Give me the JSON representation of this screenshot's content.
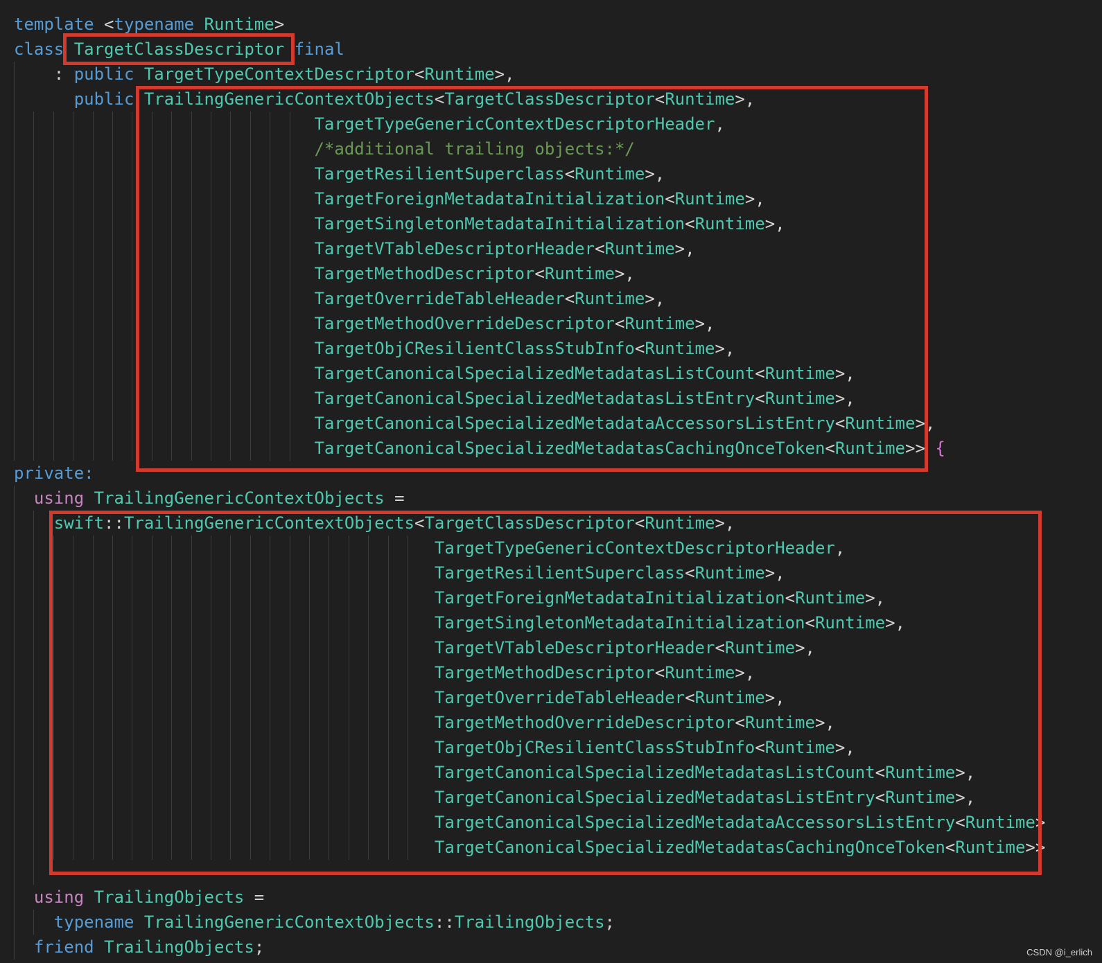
{
  "theme": {
    "background": "#1f1f1f",
    "keyword": "#569cd6",
    "control_keyword": "#c586c0",
    "type": "#4ec9b0",
    "identifier": "#9cdcfe",
    "text": "#d4d4d4",
    "comment": "#6a9955",
    "bracket": "#da70d6",
    "highlight_box": "#d13a2c"
  },
  "code_lines": [
    {
      "tokens": [
        {
          "t": "template",
          "c": "keyword"
        },
        {
          "t": " <",
          "c": "text"
        },
        {
          "t": "typename",
          "c": "keyword"
        },
        {
          "t": " ",
          "c": "text"
        },
        {
          "t": "Runtime",
          "c": "type"
        },
        {
          "t": ">",
          "c": "text"
        }
      ]
    },
    {
      "tokens": [
        {
          "t": "class",
          "c": "keyword"
        },
        {
          "t": " ",
          "c": "text"
        },
        {
          "t": "TargetClassDescriptor",
          "c": "type"
        },
        {
          "t": " ",
          "c": "text"
        },
        {
          "t": "final",
          "c": "keyword"
        }
      ]
    },
    {
      "tokens": [
        {
          "t": "    : ",
          "c": "text"
        },
        {
          "t": "public",
          "c": "keyword"
        },
        {
          "t": " ",
          "c": "text"
        },
        {
          "t": "TargetTypeContextDescriptor",
          "c": "type"
        },
        {
          "t": "<",
          "c": "text"
        },
        {
          "t": "Runtime",
          "c": "type"
        },
        {
          "t": ">,",
          "c": "text"
        }
      ]
    },
    {
      "tokens": [
        {
          "t": "      ",
          "c": "text"
        },
        {
          "t": "public",
          "c": "keyword"
        },
        {
          "t": " ",
          "c": "text"
        },
        {
          "t": "TrailingGenericContextObjects",
          "c": "type"
        },
        {
          "t": "<",
          "c": "text"
        },
        {
          "t": "TargetClassDescriptor",
          "c": "type"
        },
        {
          "t": "<",
          "c": "text"
        },
        {
          "t": "Runtime",
          "c": "type"
        },
        {
          "t": ">,",
          "c": "text"
        }
      ]
    },
    {
      "tokens": [
        {
          "t": "                              ",
          "c": "text"
        },
        {
          "t": "TargetTypeGenericContextDescriptorHeader",
          "c": "type"
        },
        {
          "t": ",",
          "c": "text"
        }
      ]
    },
    {
      "tokens": [
        {
          "t": "                              ",
          "c": "text"
        },
        {
          "t": "/*additional trailing objects:*/",
          "c": "comment"
        }
      ]
    },
    {
      "tokens": [
        {
          "t": "                              ",
          "c": "text"
        },
        {
          "t": "TargetResilientSuperclass",
          "c": "type"
        },
        {
          "t": "<",
          "c": "text"
        },
        {
          "t": "Runtime",
          "c": "type"
        },
        {
          "t": ">,",
          "c": "text"
        }
      ]
    },
    {
      "tokens": [
        {
          "t": "                              ",
          "c": "text"
        },
        {
          "t": "TargetForeignMetadataInitialization",
          "c": "type"
        },
        {
          "t": "<",
          "c": "text"
        },
        {
          "t": "Runtime",
          "c": "type"
        },
        {
          "t": ">,",
          "c": "text"
        }
      ]
    },
    {
      "tokens": [
        {
          "t": "                              ",
          "c": "text"
        },
        {
          "t": "TargetSingletonMetadataInitialization",
          "c": "type"
        },
        {
          "t": "<",
          "c": "text"
        },
        {
          "t": "Runtime",
          "c": "type"
        },
        {
          "t": ">,",
          "c": "text"
        }
      ]
    },
    {
      "tokens": [
        {
          "t": "                              ",
          "c": "text"
        },
        {
          "t": "TargetVTableDescriptorHeader",
          "c": "type"
        },
        {
          "t": "<",
          "c": "text"
        },
        {
          "t": "Runtime",
          "c": "type"
        },
        {
          "t": ">,",
          "c": "text"
        }
      ]
    },
    {
      "tokens": [
        {
          "t": "                              ",
          "c": "text"
        },
        {
          "t": "TargetMethodDescriptor",
          "c": "type"
        },
        {
          "t": "<",
          "c": "text"
        },
        {
          "t": "Runtime",
          "c": "type"
        },
        {
          "t": ">,",
          "c": "text"
        }
      ]
    },
    {
      "tokens": [
        {
          "t": "                              ",
          "c": "text"
        },
        {
          "t": "TargetOverrideTableHeader",
          "c": "type"
        },
        {
          "t": "<",
          "c": "text"
        },
        {
          "t": "Runtime",
          "c": "type"
        },
        {
          "t": ">,",
          "c": "text"
        }
      ]
    },
    {
      "tokens": [
        {
          "t": "                              ",
          "c": "text"
        },
        {
          "t": "TargetMethodOverrideDescriptor",
          "c": "type"
        },
        {
          "t": "<",
          "c": "text"
        },
        {
          "t": "Runtime",
          "c": "type"
        },
        {
          "t": ">,",
          "c": "text"
        }
      ]
    },
    {
      "tokens": [
        {
          "t": "                              ",
          "c": "text"
        },
        {
          "t": "TargetObjCResilientClassStubInfo",
          "c": "type"
        },
        {
          "t": "<",
          "c": "text"
        },
        {
          "t": "Runtime",
          "c": "type"
        },
        {
          "t": ">,",
          "c": "text"
        }
      ]
    },
    {
      "tokens": [
        {
          "t": "                              ",
          "c": "text"
        },
        {
          "t": "TargetCanonicalSpecializedMetadatasListCount",
          "c": "type"
        },
        {
          "t": "<",
          "c": "text"
        },
        {
          "t": "Runtime",
          "c": "type"
        },
        {
          "t": ">,",
          "c": "text"
        }
      ]
    },
    {
      "tokens": [
        {
          "t": "                              ",
          "c": "text"
        },
        {
          "t": "TargetCanonicalSpecializedMetadatasListEntry",
          "c": "type"
        },
        {
          "t": "<",
          "c": "text"
        },
        {
          "t": "Runtime",
          "c": "type"
        },
        {
          "t": ">,",
          "c": "text"
        }
      ]
    },
    {
      "tokens": [
        {
          "t": "                              ",
          "c": "text"
        },
        {
          "t": "TargetCanonicalSpecializedMetadataAccessorsListEntry",
          "c": "type"
        },
        {
          "t": "<",
          "c": "text"
        },
        {
          "t": "Runtime",
          "c": "type"
        },
        {
          "t": ">,",
          "c": "text"
        }
      ]
    },
    {
      "tokens": [
        {
          "t": "                              ",
          "c": "text"
        },
        {
          "t": "TargetCanonicalSpecializedMetadatasCachingOnceToken",
          "c": "type"
        },
        {
          "t": "<",
          "c": "text"
        },
        {
          "t": "Runtime",
          "c": "type"
        },
        {
          "t": ">> ",
          "c": "text"
        },
        {
          "t": "{",
          "c": "bracket"
        }
      ]
    },
    {
      "tokens": [
        {
          "t": "private:",
          "c": "keyword"
        }
      ]
    },
    {
      "tokens": [
        {
          "t": "  ",
          "c": "text"
        },
        {
          "t": "using",
          "c": "control_keyword"
        },
        {
          "t": " ",
          "c": "text"
        },
        {
          "t": "TrailingGenericContextObjects",
          "c": "type"
        },
        {
          "t": " =",
          "c": "text"
        }
      ]
    },
    {
      "tokens": [
        {
          "t": "    ",
          "c": "text"
        },
        {
          "t": "swift",
          "c": "type"
        },
        {
          "t": "::",
          "c": "text"
        },
        {
          "t": "TrailingGenericContextObjects",
          "c": "type"
        },
        {
          "t": "<",
          "c": "text"
        },
        {
          "t": "TargetClassDescriptor",
          "c": "type"
        },
        {
          "t": "<",
          "c": "text"
        },
        {
          "t": "Runtime",
          "c": "type"
        },
        {
          "t": ">,",
          "c": "text"
        }
      ]
    },
    {
      "tokens": [
        {
          "t": "                                          ",
          "c": "text"
        },
        {
          "t": "TargetTypeGenericContextDescriptorHeader",
          "c": "type"
        },
        {
          "t": ",",
          "c": "text"
        }
      ]
    },
    {
      "tokens": [
        {
          "t": "                                          ",
          "c": "text"
        },
        {
          "t": "TargetResilientSuperclass",
          "c": "type"
        },
        {
          "t": "<",
          "c": "text"
        },
        {
          "t": "Runtime",
          "c": "type"
        },
        {
          "t": ">,",
          "c": "text"
        }
      ]
    },
    {
      "tokens": [
        {
          "t": "                                          ",
          "c": "text"
        },
        {
          "t": "TargetForeignMetadataInitialization",
          "c": "type"
        },
        {
          "t": "<",
          "c": "text"
        },
        {
          "t": "Runtime",
          "c": "type"
        },
        {
          "t": ">,",
          "c": "text"
        }
      ]
    },
    {
      "tokens": [
        {
          "t": "                                          ",
          "c": "text"
        },
        {
          "t": "TargetSingletonMetadataInitialization",
          "c": "type"
        },
        {
          "t": "<",
          "c": "text"
        },
        {
          "t": "Runtime",
          "c": "type"
        },
        {
          "t": ">,",
          "c": "text"
        }
      ]
    },
    {
      "tokens": [
        {
          "t": "                                          ",
          "c": "text"
        },
        {
          "t": "TargetVTableDescriptorHeader",
          "c": "type"
        },
        {
          "t": "<",
          "c": "text"
        },
        {
          "t": "Runtime",
          "c": "type"
        },
        {
          "t": ">,",
          "c": "text"
        }
      ]
    },
    {
      "tokens": [
        {
          "t": "                                          ",
          "c": "text"
        },
        {
          "t": "TargetMethodDescriptor",
          "c": "type"
        },
        {
          "t": "<",
          "c": "text"
        },
        {
          "t": "Runtime",
          "c": "type"
        },
        {
          "t": ">,",
          "c": "text"
        }
      ]
    },
    {
      "tokens": [
        {
          "t": "                                          ",
          "c": "text"
        },
        {
          "t": "TargetOverrideTableHeader",
          "c": "type"
        },
        {
          "t": "<",
          "c": "text"
        },
        {
          "t": "Runtime",
          "c": "type"
        },
        {
          "t": ">,",
          "c": "text"
        }
      ]
    },
    {
      "tokens": [
        {
          "t": "                                          ",
          "c": "text"
        },
        {
          "t": "TargetMethodOverrideDescriptor",
          "c": "type"
        },
        {
          "t": "<",
          "c": "text"
        },
        {
          "t": "Runtime",
          "c": "type"
        },
        {
          "t": ">,",
          "c": "text"
        }
      ]
    },
    {
      "tokens": [
        {
          "t": "                                          ",
          "c": "text"
        },
        {
          "t": "TargetObjCResilientClassStubInfo",
          "c": "type"
        },
        {
          "t": "<",
          "c": "text"
        },
        {
          "t": "Runtime",
          "c": "type"
        },
        {
          "t": ">,",
          "c": "text"
        }
      ]
    },
    {
      "tokens": [
        {
          "t": "                                          ",
          "c": "text"
        },
        {
          "t": "TargetCanonicalSpecializedMetadatasListCount",
          "c": "type"
        },
        {
          "t": "<",
          "c": "text"
        },
        {
          "t": "Runtime",
          "c": "type"
        },
        {
          "t": ">,",
          "c": "text"
        }
      ]
    },
    {
      "tokens": [
        {
          "t": "                                          ",
          "c": "text"
        },
        {
          "t": "TargetCanonicalSpecializedMetadatasListEntry",
          "c": "type"
        },
        {
          "t": "<",
          "c": "text"
        },
        {
          "t": "Runtime",
          "c": "type"
        },
        {
          "t": ">,",
          "c": "text"
        }
      ]
    },
    {
      "tokens": [
        {
          "t": "                                          ",
          "c": "text"
        },
        {
          "t": "TargetCanonicalSpecializedMetadataAccessorsListEntry",
          "c": "type"
        },
        {
          "t": "<",
          "c": "text"
        },
        {
          "t": "Runtime",
          "c": "type"
        },
        {
          "t": ">",
          "c": "text"
        }
      ]
    },
    {
      "tokens": [
        {
          "t": "                                          ",
          "c": "text"
        },
        {
          "t": "TargetCanonicalSpecializedMetadatasCachingOnceToken",
          "c": "type"
        },
        {
          "t": "<",
          "c": "text"
        },
        {
          "t": "Runtime",
          "c": "type"
        },
        {
          "t": ">>",
          "c": "text"
        }
      ]
    },
    {
      "tokens": []
    },
    {
      "tokens": [
        {
          "t": "  ",
          "c": "text"
        },
        {
          "t": "using",
          "c": "control_keyword"
        },
        {
          "t": " ",
          "c": "text"
        },
        {
          "t": "TrailingObjects",
          "c": "type"
        },
        {
          "t": " =",
          "c": "text"
        }
      ]
    },
    {
      "tokens": [
        {
          "t": "    ",
          "c": "text"
        },
        {
          "t": "typename",
          "c": "keyword"
        },
        {
          "t": " ",
          "c": "text"
        },
        {
          "t": "TrailingGenericContextObjects",
          "c": "type"
        },
        {
          "t": "::",
          "c": "text"
        },
        {
          "t": "TrailingObjects",
          "c": "type"
        },
        {
          "t": ";",
          "c": "text"
        }
      ]
    },
    {
      "tokens": [
        {
          "t": "  ",
          "c": "text"
        },
        {
          "t": "friend",
          "c": "keyword"
        },
        {
          "t": " ",
          "c": "text"
        },
        {
          "t": "TrailingObjects",
          "c": "type"
        },
        {
          "t": ";",
          "c": "text"
        }
      ]
    }
  ],
  "watermark": "CSDN @i_erlich"
}
